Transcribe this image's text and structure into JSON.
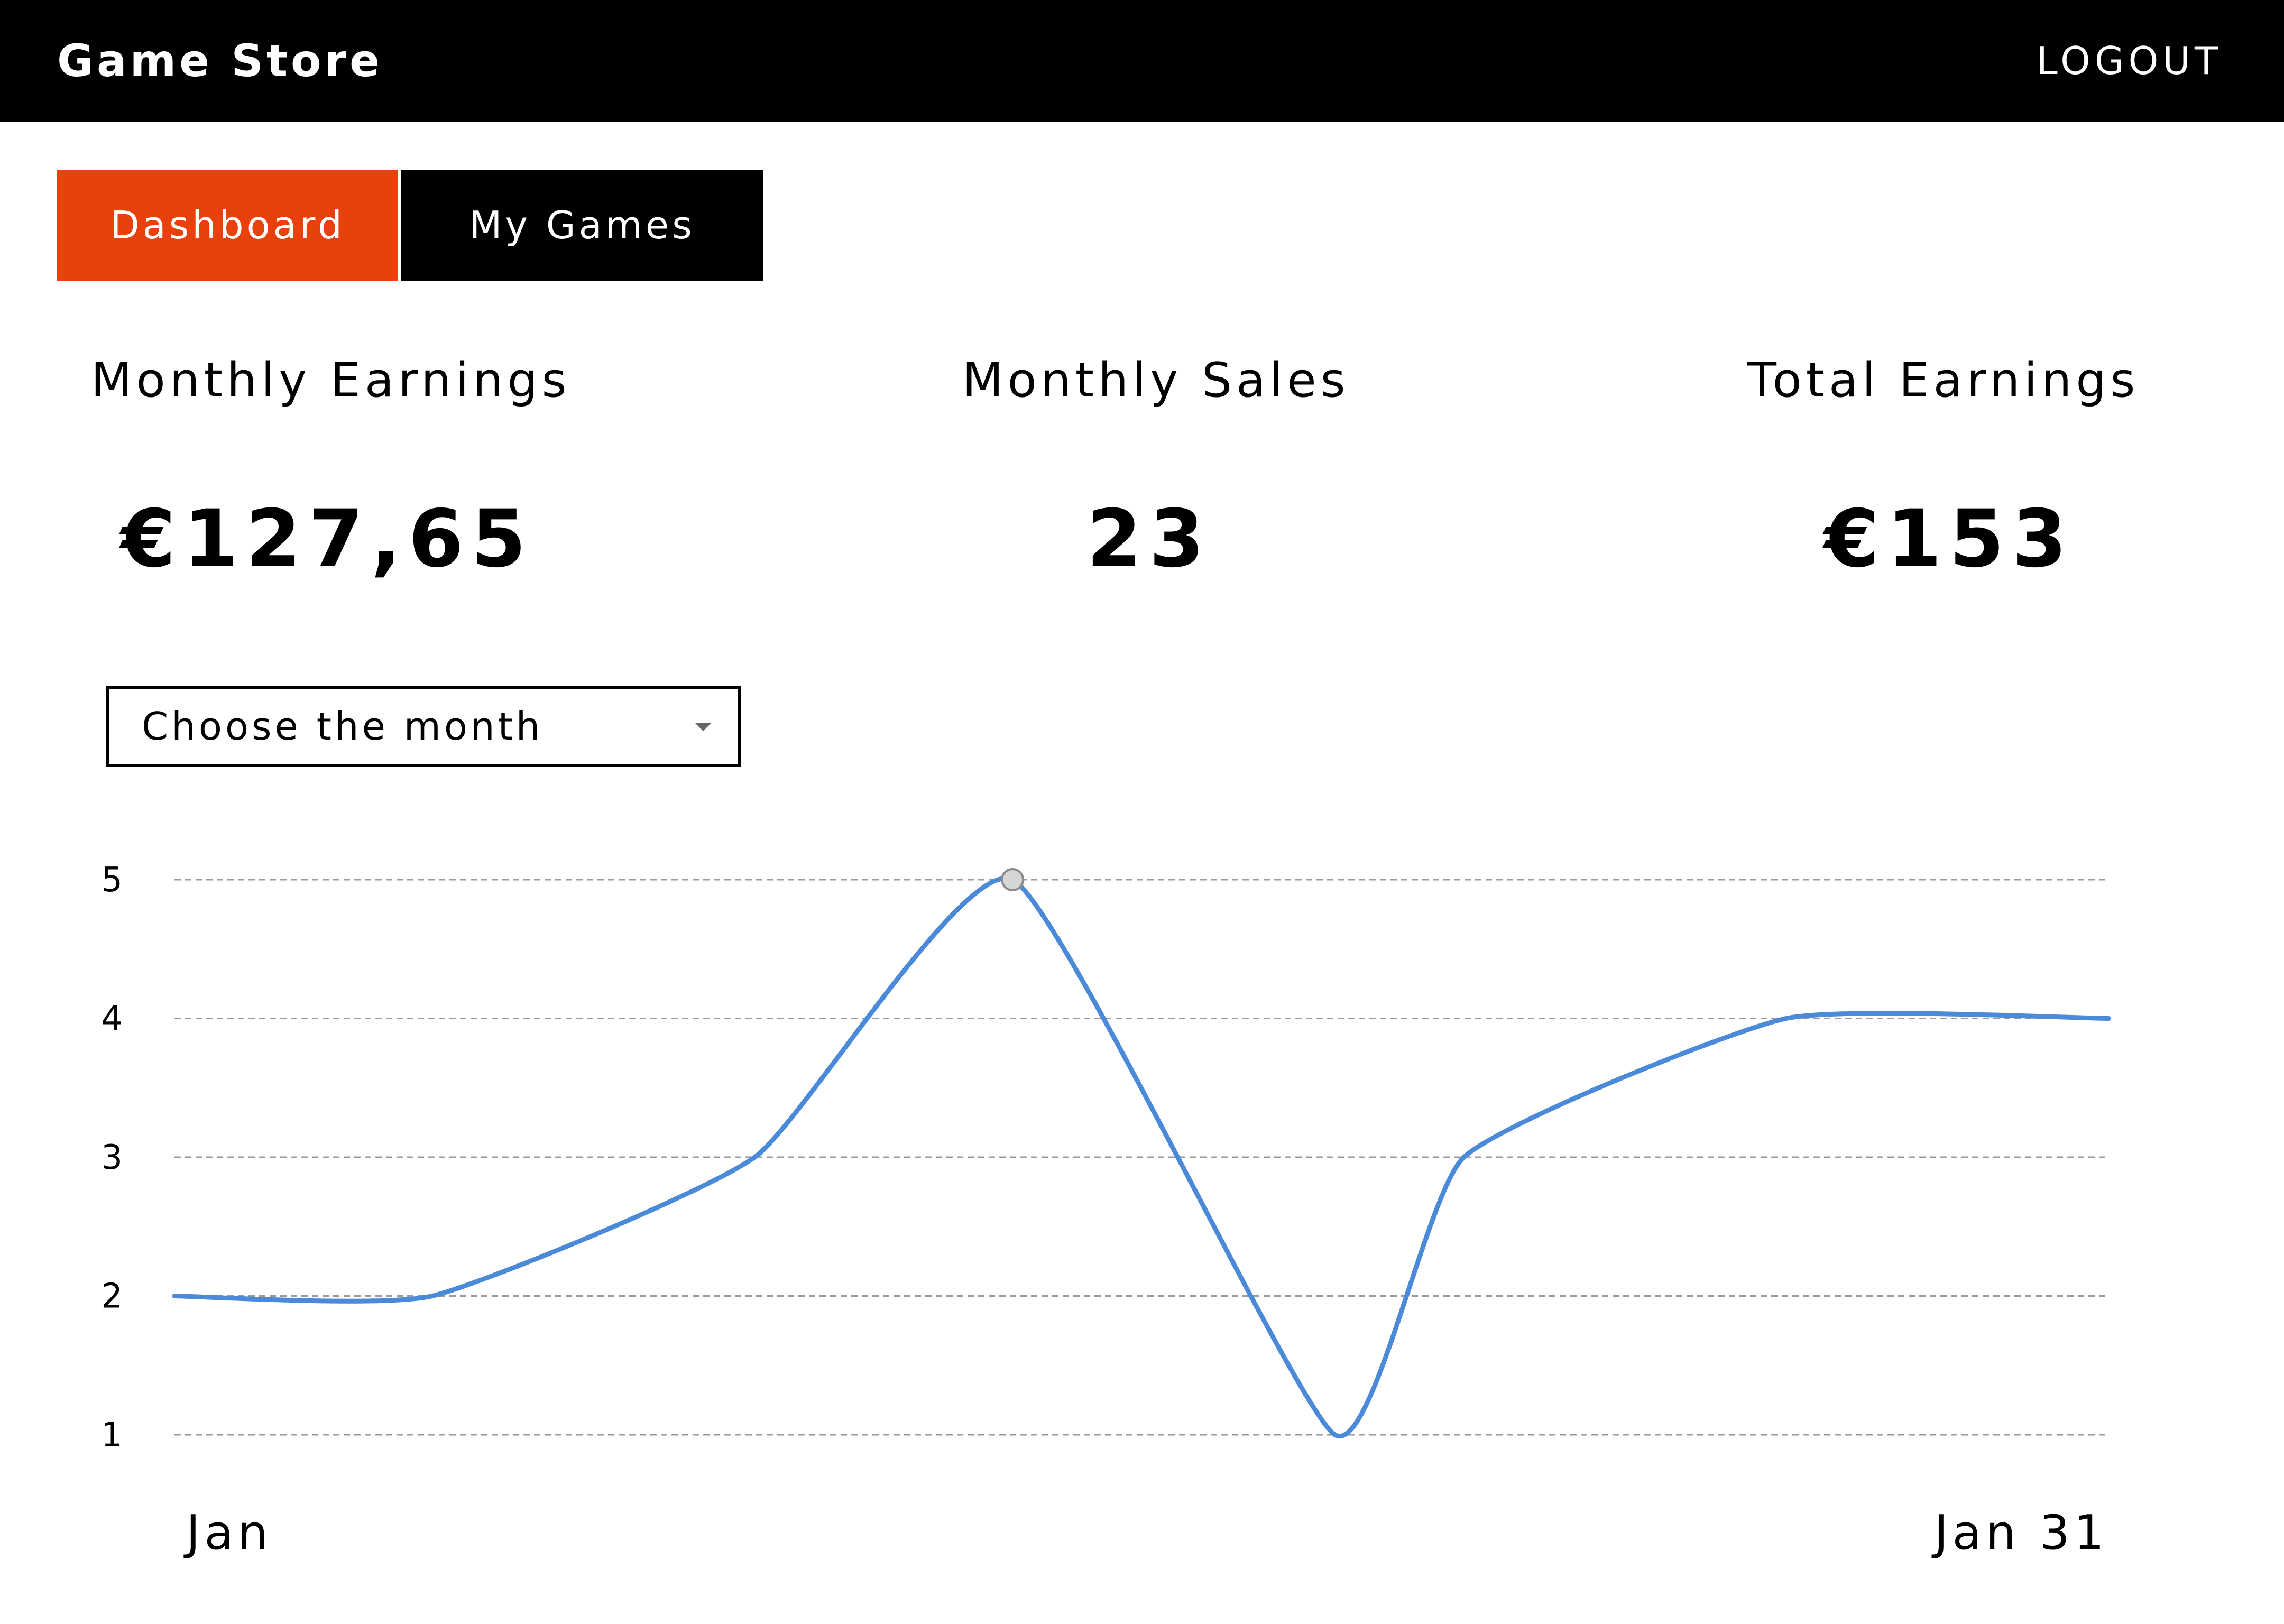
{
  "header": {
    "title": "Game Store",
    "logout_label": "LOGOUT"
  },
  "tabs": [
    {
      "label": "Dashboard",
      "active": true
    },
    {
      "label": "My Games",
      "active": false
    }
  ],
  "stats": [
    {
      "label": "Monthly Earnings",
      "value": "€127,65"
    },
    {
      "label": "Monthly Sales",
      "value": "23"
    },
    {
      "label": "Total Earnings",
      "value": "€153"
    }
  ],
  "month_select": {
    "selected": "Choose the month"
  },
  "colors": {
    "topbar_bg": "#000000",
    "active_tab": "#e8410b",
    "inactive_tab": "#000000",
    "line": "#4a8ad8",
    "grid": "#9a9a9a",
    "marker": "#d6d6d6"
  },
  "chart_data": {
    "type": "line",
    "x": [
      1,
      5,
      10,
      14,
      19,
      21,
      26,
      31
    ],
    "values": [
      2,
      2,
      3,
      5,
      1,
      3,
      4,
      4
    ],
    "x_tick_labels": [
      "Jan",
      "Jan 31"
    ],
    "y_ticks": [
      1,
      2,
      3,
      4,
      5
    ],
    "ylim": [
      1,
      5
    ],
    "xlim": [
      1,
      31
    ],
    "grid": true,
    "highlighted_point": {
      "x": 14,
      "y": 5
    }
  }
}
